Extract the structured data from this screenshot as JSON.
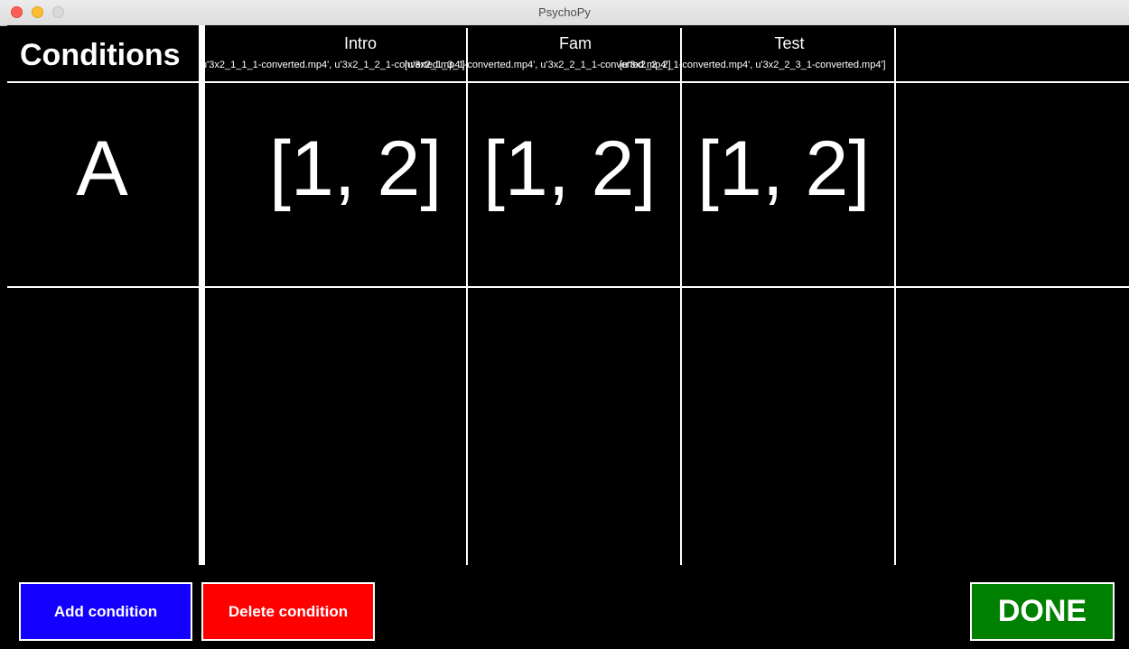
{
  "window": {
    "title": "PsychoPy"
  },
  "colors": {
    "background": "#000000",
    "add_button": "#1400ff",
    "delete_button": "#ff0000",
    "done_button": "#008000"
  },
  "table": {
    "heading": "Conditions",
    "columns": [
      {
        "label": "Intro"
      },
      {
        "label": "Fam"
      },
      {
        "label": "Test"
      }
    ],
    "file_lists": [
      "[u'3x2_1_1_1-converted.mp4', u'3x2_1_2_1-converted.mp4']",
      "[u'3x2_1_3_1-converted.mp4', u'3x2_2_1_1-converted.mp4']",
      "[u'3x2_2_2_1-converted.mp4', u'3x2_2_3_1-converted.mp4']"
    ],
    "rows": [
      {
        "name": "A",
        "values": [
          "[1, 2]",
          "[1, 2]",
          "[1, 2]"
        ]
      }
    ]
  },
  "buttons": {
    "add": "Add condition",
    "delete": "Delete condition",
    "done": "DONE"
  }
}
